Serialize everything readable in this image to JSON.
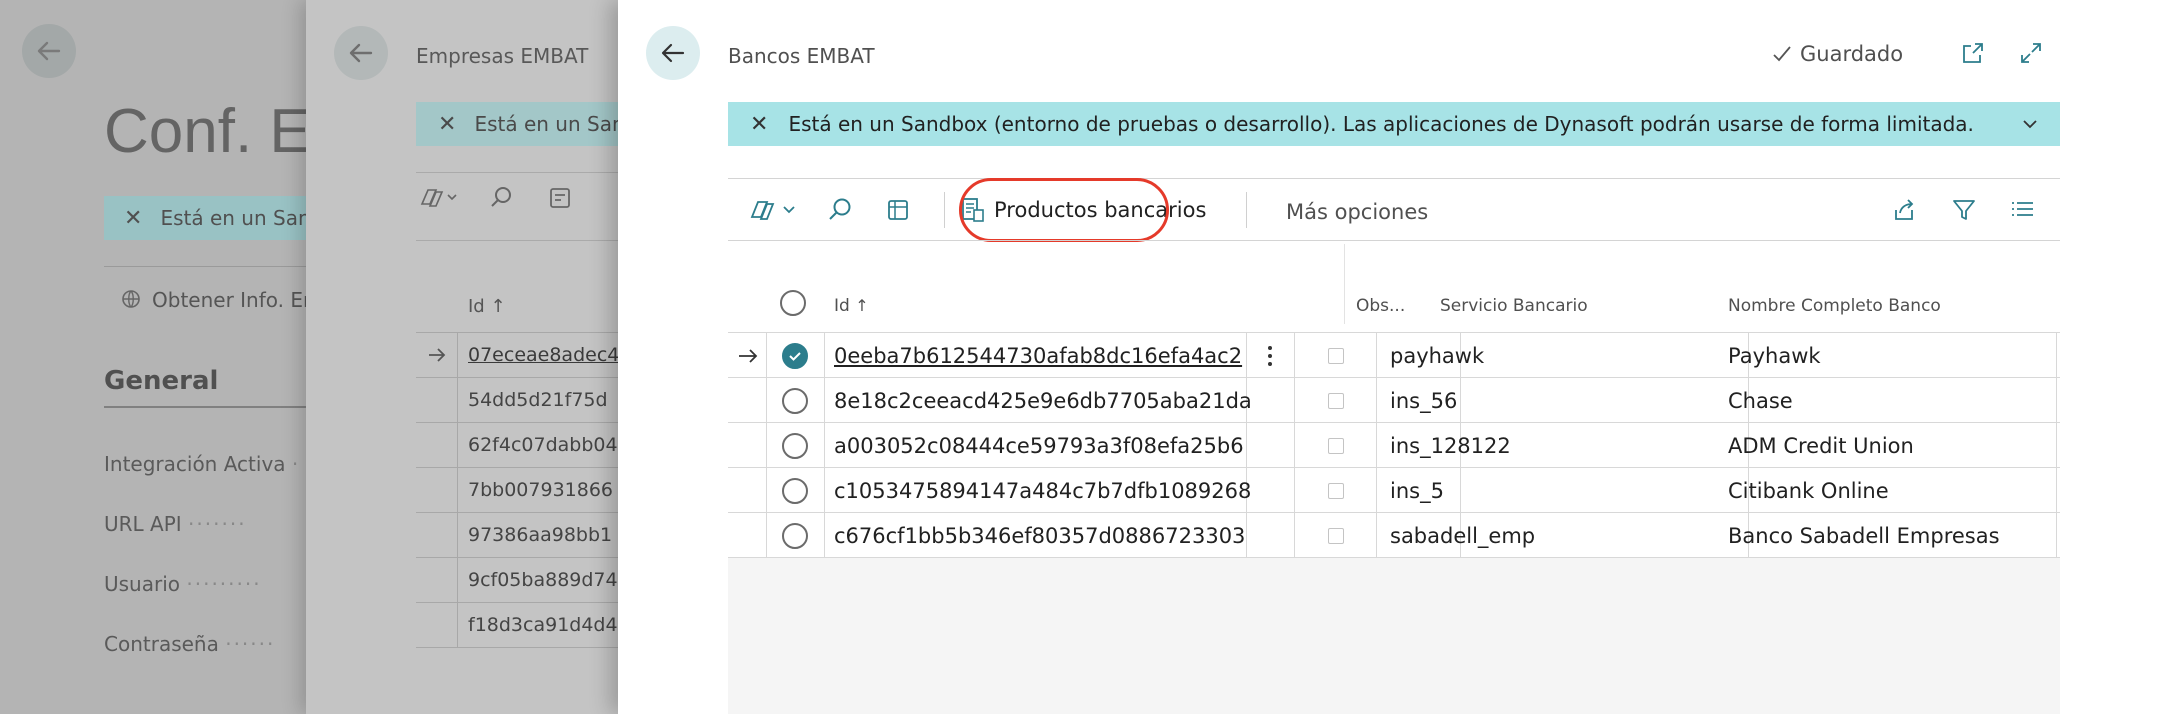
{
  "panel1": {
    "title": "Conf. EMBAT",
    "sandbox_text": "Está en un Sandbox",
    "action_label": "Obtener Info. Empresas",
    "section_title": "General",
    "fields": [
      "Integración Activa",
      "URL API",
      "Usuario",
      "Contraseña"
    ]
  },
  "panel2": {
    "title": "Empresas EMBAT",
    "sandbox_text": "Está en un Sandbox",
    "column_id": "Id",
    "rows": [
      "07eceae8adec4",
      "54dd5d21f75d",
      "62f4c07dabb04",
      "7bb007931866",
      "97386aa98bb1",
      "9cf05ba889d74",
      "f18d3ca91d4d4"
    ]
  },
  "panel3": {
    "title": "Bancos EMBAT",
    "saved_label": "Guardado",
    "sandbox_text": "Está en un Sandbox (entorno de pruebas o desarrollo). Las aplicaciones de Dynasoft podrán usarse de forma limitada.",
    "toolbar": {
      "productos_label": "Productos bancarios",
      "more_label": "Más opciones"
    },
    "columns": {
      "id": "Id",
      "obs": "Obs...",
      "servicio": "Servicio Bancario",
      "nombre": "Nombre Completo Banco"
    },
    "rows": [
      {
        "id": "0eeba7b612544730afab8dc16efa4ac2",
        "servicio": "payhawk",
        "nombre": "Payhawk"
      },
      {
        "id": "8e18c2ceeacd425e9e6db7705aba21da",
        "servicio": "ins_56",
        "nombre": "Chase"
      },
      {
        "id": "a003052c08444ce59793a3f08efa25b6",
        "servicio": "ins_128122",
        "nombre": "ADM Credit Union"
      },
      {
        "id": "c1053475894147a484c7b7dfb1089268",
        "servicio": "ins_5",
        "nombre": "Citibank Online"
      },
      {
        "id": "c676cf1bb5b346ef80357d0886723303",
        "servicio": "sabadell_emp",
        "nombre": "Banco Sabadell Empresas"
      }
    ]
  },
  "colors": {
    "accent": "#2c7d8c",
    "sandbox_banner": "#a7e3e6",
    "highlight_ring": "#e53a2a"
  }
}
